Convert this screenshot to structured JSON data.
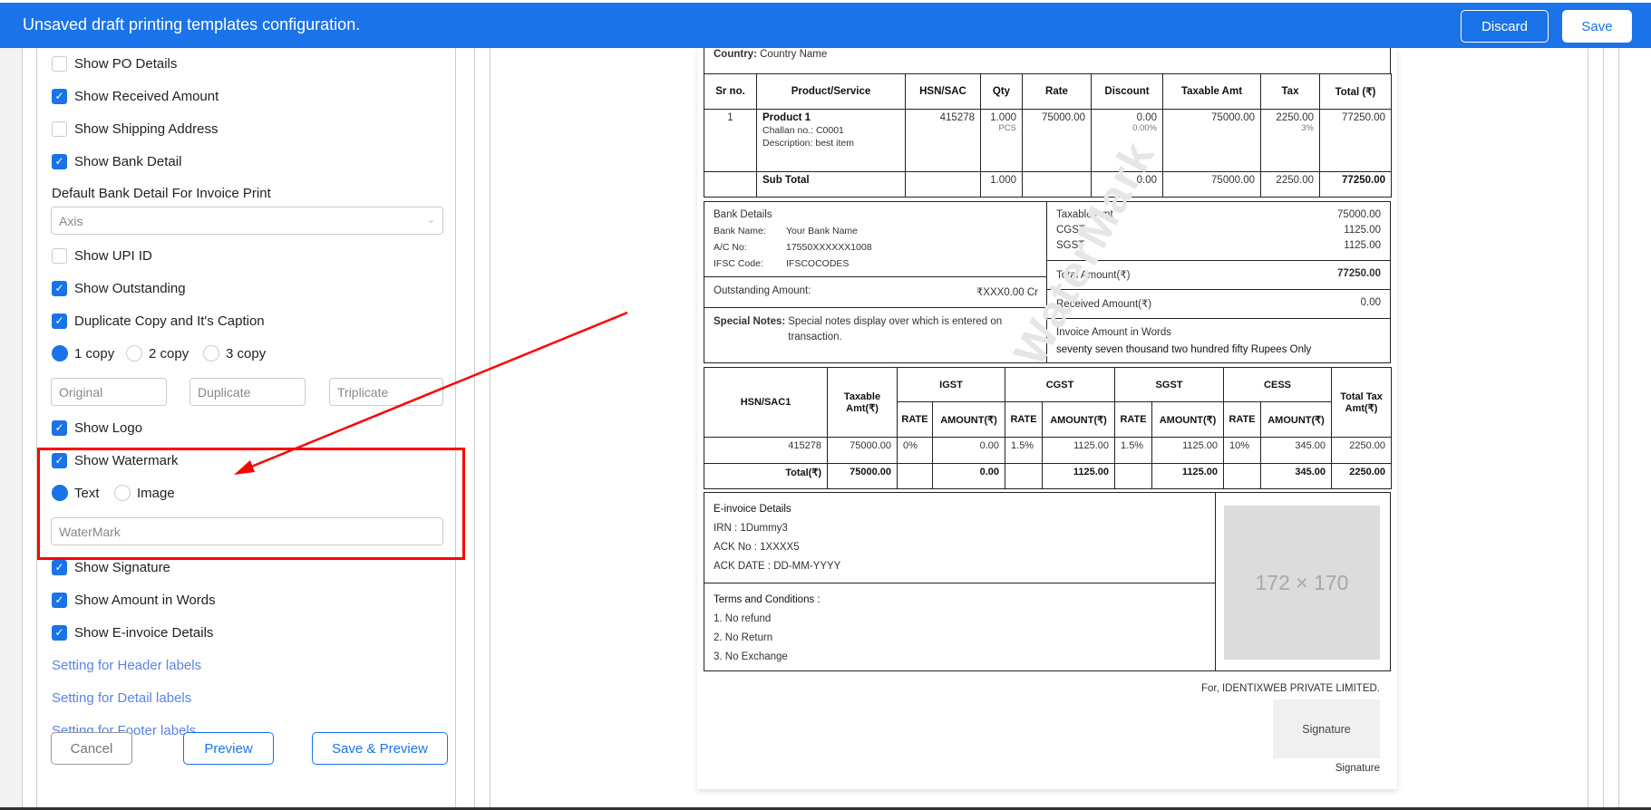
{
  "topbar": {
    "title": "Unsaved draft printing templates configuration.",
    "discard": "Discard",
    "save": "Save"
  },
  "settings": {
    "items": [
      {
        "label": "Show PO Details",
        "checked": false
      },
      {
        "label": "Show Received Amount",
        "checked": true
      },
      {
        "label": "Show Shipping Address",
        "checked": false
      },
      {
        "label": "Show Bank Detail",
        "checked": true
      },
      {
        "label": "Show UPI ID",
        "checked": false
      },
      {
        "label": "Show Outstanding",
        "checked": true
      },
      {
        "label": "Duplicate Copy and It's Caption",
        "checked": true
      },
      {
        "label": "Show Logo",
        "checked": true
      },
      {
        "label": "Show Watermark",
        "checked": true
      },
      {
        "label": "Show Signature",
        "checked": true
      },
      {
        "label": "Show Amount in Words",
        "checked": true
      },
      {
        "label": "Show E-invoice Details",
        "checked": true
      }
    ],
    "bank_label": "Default Bank Detail For Invoice Print",
    "bank_value": "Axis",
    "copies": [
      {
        "label": "1 copy",
        "selected": true
      },
      {
        "label": "2 copy",
        "selected": false
      },
      {
        "label": "3 copy",
        "selected": false
      }
    ],
    "copy_placeholders": [
      "Original",
      "Duplicate",
      "Triplicate"
    ],
    "watermark_types": [
      {
        "label": "Text",
        "selected": true
      },
      {
        "label": "Image",
        "selected": false
      }
    ],
    "watermark_value": "WaterMark",
    "links": [
      "Setting for Header labels",
      "Setting for Detail labels",
      "Setting for Footer labels"
    ],
    "buttons": {
      "cancel": "Cancel",
      "preview": "Preview",
      "save_preview": "Save & Preview"
    }
  },
  "invoice": {
    "country_label": "Country:",
    "country": "Country Name",
    "headers": [
      "Sr no.",
      "Product/Service",
      "HSN/SAC",
      "Qty",
      "Rate",
      "Discount",
      "Taxable Amt",
      "Tax",
      "Total (₹)"
    ],
    "item": {
      "sr": "1",
      "name": "Product 1",
      "challan": "Challan no.: C0001",
      "desc": "Description: best item",
      "hsn": "415278",
      "qty": "1.000",
      "unit": "PCS",
      "rate": "75000.00",
      "discount": "0.00",
      "discount_pct": "0.00%",
      "taxable": "75000.00",
      "tax": "2250.00",
      "tax_pct": "3%",
      "total": "77250.00"
    },
    "subtotal": {
      "label": "Sub Total",
      "qty": "1.000",
      "discount": "0.00",
      "taxable": "75000.00",
      "tax": "2250.00",
      "total": "77250.00"
    },
    "bank": {
      "title": "Bank Details",
      "name_label": "Bank Name:",
      "name": "Your Bank Name",
      "ac_label": "A/C No:",
      "ac": "17550XXXXXX1008",
      "ifsc_label": "IFSC Code:",
      "ifsc": "IFSCOCODES"
    },
    "outstanding": {
      "label": "Outstanding Amount:",
      "value": "₹XXX0.00 Cr"
    },
    "notes": {
      "label": "Special Notes:",
      "value": "Special notes display over which is entered on transaction."
    },
    "amounts": {
      "taxable_label": "Taxable Amt",
      "taxable": "75000.00",
      "cgst_label": "CGST",
      "cgst": "1125.00",
      "sgst_label": "SGST",
      "sgst": "1125.00",
      "total_label": "Total Amount(₹)",
      "total": "77250.00",
      "received_label": "Received Amount(₹)",
      "received": "0.00",
      "words_label": "Invoice Amount in Words",
      "words": "seventy seven thousand two hundred fifty Rupees Only"
    },
    "tax_table": {
      "hsn": "HSN/SAC1",
      "taxable": "Taxable Amt(₹)",
      "groups": [
        "IGST",
        "CGST",
        "SGST",
        "CESS"
      ],
      "rate": "RATE",
      "amount": "AMOUNT(₹)",
      "total": "Total Tax Amt(₹)",
      "row": [
        "415278",
        "75000.00",
        "0%",
        "0.00",
        "1.5%",
        "1125.00",
        "1.5%",
        "1125.00",
        "10%",
        "345.00",
        "2250.00"
      ],
      "total_row": [
        "Total(₹)",
        "75000.00",
        "",
        "0.00",
        "",
        "1125.00",
        "",
        "1125.00",
        "",
        "345.00",
        "2250.00"
      ]
    },
    "einvoice": {
      "title": "E-invoice Details",
      "irn": "IRN : 1Dummy3",
      "ack_no": "ACK No : 1XXXX5",
      "ack_date": "ACK DATE : DD-MM-YYYY"
    },
    "terms": {
      "title": "Terms and Conditions :",
      "items": [
        "1. No refund",
        "2. No Return",
        "3. No Exchange"
      ]
    },
    "image_placeholder": "172 × 170",
    "for_company": "For, IDENTIXWEB PRIVATE LIMITED.",
    "signature_box": "Signature",
    "signature_caption": "Signature",
    "watermark": "WaterMark"
  }
}
